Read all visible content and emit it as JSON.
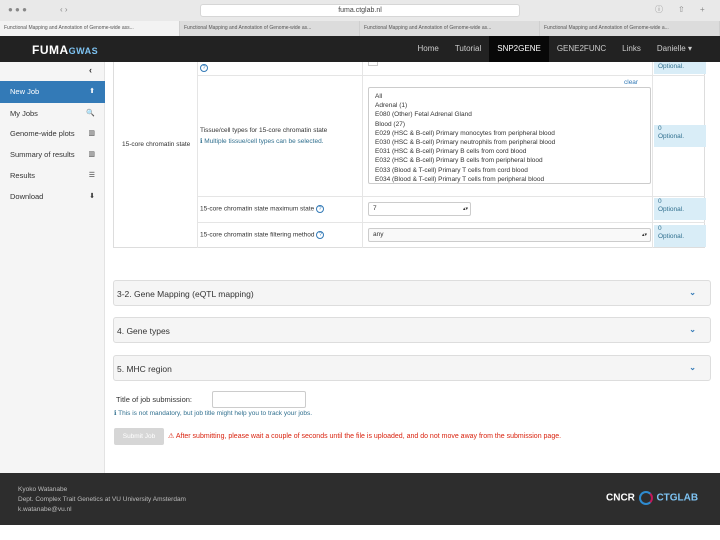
{
  "browser": {
    "url": "fuma.ctglab.nl",
    "tabs": [
      "Functional Mapping and Annotation of Genome-wide ass...",
      "Functional Mapping and Annotation of Genome-wide as...",
      "Functional Mapping and Annotation of Genome-wide as...",
      "Functional Mapping and Annotation of Genome-wide a..."
    ]
  },
  "navbar": {
    "logo_main": "FUMA",
    "logo_sub": "GWAS",
    "items": [
      "Home",
      "Tutorial",
      "SNP2GENE",
      "GENE2FUNC",
      "Links",
      "Danielle ▾"
    ]
  },
  "sidebar": {
    "items": [
      {
        "label": "New Job",
        "icon": "⬆"
      },
      {
        "label": "My Jobs",
        "icon": "🔍"
      },
      {
        "label": "Genome-wide plots",
        "icon": "▥"
      },
      {
        "label": "Summary of results",
        "icon": "▥"
      },
      {
        "label": "Results",
        "icon": "☰"
      },
      {
        "label": "Download",
        "icon": "⬇"
      }
    ]
  },
  "chromatin": {
    "section_label": "15-core chromatin state",
    "tissue_label": "Tissue/cell types for 15-core chromatin state",
    "tissue_info": "ℹ Multiple tissue/cell types can be selected.",
    "clear": "clear",
    "tissue_options": [
      "All",
      "Adrenal (1)",
      "E080 (Other) Fetal Adrenal Gland",
      "Blood (27)",
      "E029 (HSC & B-cell) Primary monocytes from peripheral blood",
      "E030 (HSC & B-cell) Primary neutrophils from peripheral blood",
      "E031 (HSC & B-cell) Primary B cells from cord blood",
      "E032 (HSC & B-cell) Primary B cells from peripheral blood",
      "E033 (Blood & T-cell) Primary T cells from cord blood",
      "E034 (Blood & T-cell) Primary T cells from peripheral blood"
    ],
    "max_state_label": "15-core chromatin state maximum state",
    "max_state_value": "7",
    "filter_label": "15-core chromatin state filtering method",
    "filter_value": "any",
    "optional_badges": [
      {
        "count": "",
        "text": "Optional."
      },
      {
        "count": "0",
        "text": "Optional."
      },
      {
        "count": "0",
        "text": "Optional."
      },
      {
        "count": "0",
        "text": "Optional."
      }
    ]
  },
  "panels": [
    "3-2. Gene Mapping (eQTL mapping)",
    "4. Gene types",
    "5. MHC region"
  ],
  "submission": {
    "title_label": "Title of job submission:",
    "title_info": "ℹ This is not mandatory, but job title might help you to track your jobs.",
    "submit_label": "Submit Job",
    "warning": "⚠ After submitting, please wait a couple of seconds until the file is uploaded, and do not move away from the submission page."
  },
  "footer": {
    "lines": [
      "Kyoko Watanabe",
      "Dept. Complex Trait Genetics at VU University Amsterdam",
      "k.watanabe@vu.nl"
    ],
    "logo_left": "CNCR",
    "logo_right": "CTGLAB"
  },
  "colors": {
    "accent": "#337ab7",
    "warning": "#d9230f",
    "navbar": "#222222"
  }
}
